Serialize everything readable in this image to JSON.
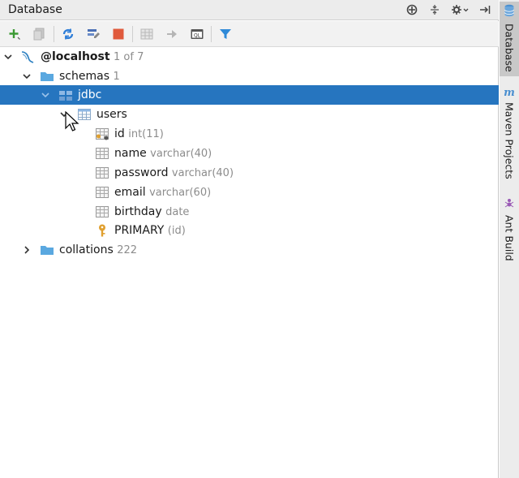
{
  "window": {
    "title": "Database"
  },
  "titlebar_icons": [
    "crosshair-icon",
    "collapse-icon",
    "gear-dropdown-icon",
    "hide-icon"
  ],
  "toolbar": {
    "buttons": [
      "add-icon",
      "duplicate-icon",
      "refresh-icon",
      "properties-icon",
      "stop-icon",
      "table-editor-icon",
      "jump-icon",
      "console-icon",
      "filter-icon"
    ]
  },
  "tree": {
    "host": {
      "name": "@localhost",
      "meta": "1 of 7"
    },
    "schemas": {
      "name": "schemas",
      "count": "1"
    },
    "jdbc": {
      "name": "jdbc"
    },
    "users": {
      "name": "users"
    },
    "columns": [
      {
        "name": "id",
        "type": "int(11)"
      },
      {
        "name": "name",
        "type": "varchar(40)"
      },
      {
        "name": "password",
        "type": "varchar(40)"
      },
      {
        "name": "email",
        "type": "varchar(60)"
      },
      {
        "name": "birthday",
        "type": "date"
      }
    ],
    "key": {
      "name": "PRIMARY",
      "cols": "(id)"
    },
    "collations": {
      "name": "collations",
      "count": "222"
    }
  },
  "sidebar": {
    "tabs": [
      {
        "label": "Database",
        "icon": "database-icon"
      },
      {
        "label": "Maven Projects",
        "icon": "maven-icon"
      },
      {
        "label": "Ant Build",
        "icon": "ant-icon"
      }
    ]
  },
  "colors": {
    "selection": "#2675bf",
    "folder": "#5aa8e0",
    "accent": "#2f8ad8"
  }
}
